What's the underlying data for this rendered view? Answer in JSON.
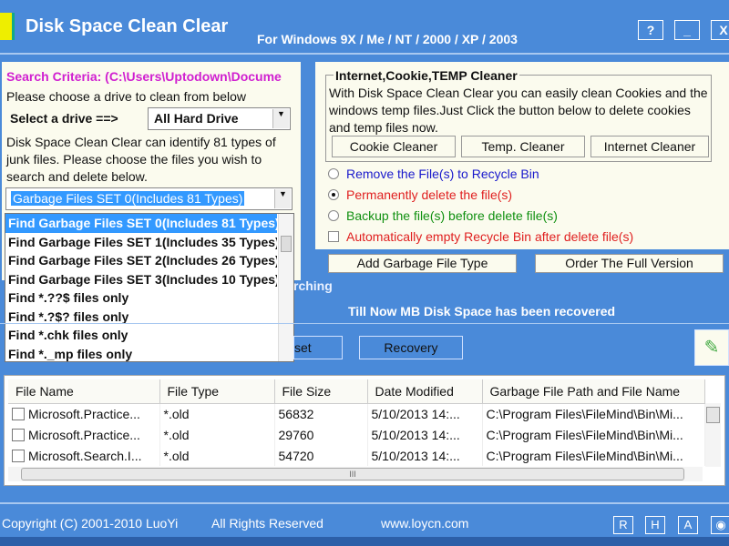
{
  "header": {
    "title": "Disk Space Clean Clear",
    "subtitle": "For Windows 9X / Me / NT / 2000 / XP / 2003",
    "help": "?",
    "minimize": "_",
    "close": "X"
  },
  "left": {
    "criteria": "Search Criteria: (C:\\Users\\Uptodown\\Docume",
    "choose_drive": "Please choose a drive to clean from below",
    "select_label": "Select a drive ==>",
    "drive_value": "All Hard Drive",
    "description": "Disk Space Clean Clear can identify 81 types of junk files. Please choose the files you wish to search and delete below.",
    "set_value": "Garbage Files SET 0(Includes 81 Types)",
    "options": [
      "Find Garbage Files SET 0(Includes 81 Types)",
      "Find Garbage Files SET 1(Includes 35 Types)",
      "Find Garbage Files SET 2(Includes 26 Types)",
      "Find Garbage Files SET 3(Includes 10 Types)",
      "Find *.??$ files only",
      "Find *.?$? files only",
      "Find *.chk files only",
      "Find *._mp files only"
    ]
  },
  "right": {
    "group_title": "Internet,Cookie,TEMP Cleaner",
    "group_text": "With Disk Space Clean Clear you can easily clean Cookies and the windows temp files.Just Click the button below to delete cookies and temp files now.",
    "cookie_btn": "Cookie Cleaner",
    "temp_btn": "Temp. Cleaner",
    "internet_btn": "Internet Cleaner",
    "radio1": "Remove the File(s) to Recycle Bin",
    "radio2": "Permanently delete the file(s)",
    "radio3": "Backup the file(s) before delete file(s)",
    "checkbox": "Automatically empty Recycle Bin after delete file(s)",
    "selected_radio": 2,
    "add_btn": "Add Garbage File Type",
    "order_btn": "Order The Full Version"
  },
  "status": {
    "searching": "rching",
    "recovered": "Till Now MB Disk Space has been recovered"
  },
  "actions": {
    "reset": "set",
    "recovery": "Recovery"
  },
  "table": {
    "columns": [
      "File Name",
      "File Type",
      "File Size",
      "Date Modified",
      "Garbage File Path and File Name"
    ],
    "rows": [
      [
        "Microsoft.Practice...",
        "*.old",
        "56832",
        "5/10/2013 14:...",
        "C:\\Program Files\\FileMind\\Bin\\Mi..."
      ],
      [
        "Microsoft.Practice...",
        "*.old",
        "29760",
        "5/10/2013 14:...",
        "C:\\Program Files\\FileMind\\Bin\\Mi..."
      ],
      [
        "Microsoft.Search.I...",
        "*.old",
        "54720",
        "5/10/2013 14:...",
        "C:\\Program Files\\FileMind\\Bin\\Mi..."
      ]
    ]
  },
  "footer": {
    "copyright": "Copyright (C) 2001-2010 LuoYi",
    "rights": "All Rights Reserved",
    "website": "www.loycn.com",
    "btn_r": "R",
    "btn_h": "H",
    "btn_a": "A"
  },
  "colors": {
    "background": "#4a8ad9",
    "criteria": "#d020d0",
    "radio1": "#1a1acc",
    "radio2": "#e02020",
    "radio3": "#109010",
    "checkbox": "#e02020",
    "selection": "#3399ff"
  }
}
